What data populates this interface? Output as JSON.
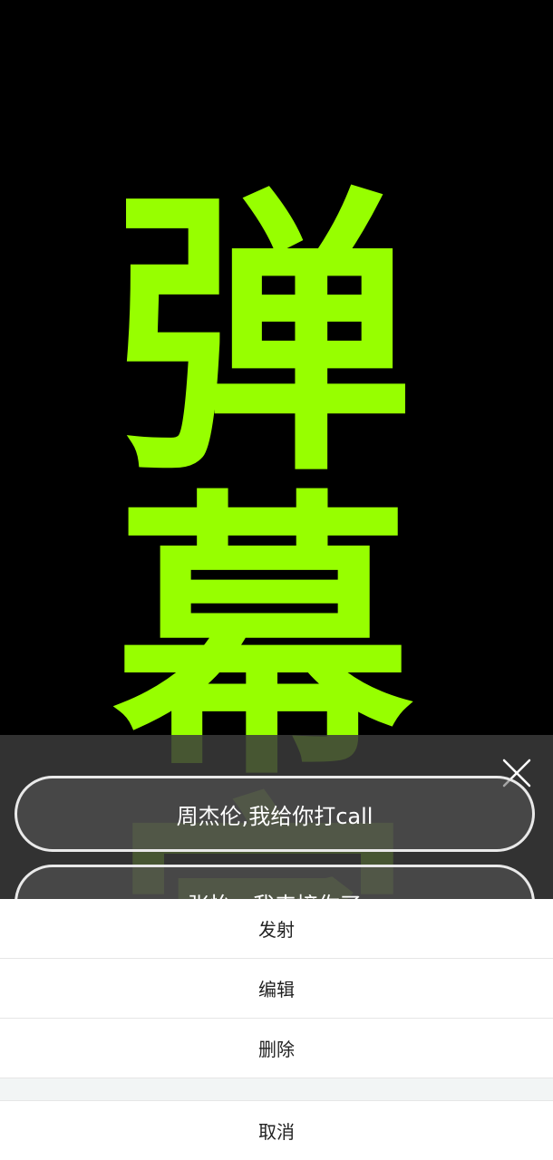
{
  "hero": {
    "chars": [
      "弹",
      "幕",
      "字"
    ],
    "color": "#97ff00"
  },
  "overlay": {
    "close_icon": "close-icon",
    "items": [
      {
        "label": "周杰伦,我给你打call"
      },
      {
        "label": "张怡，我来接你了"
      }
    ]
  },
  "sheet": {
    "actions": [
      {
        "label": "发射"
      },
      {
        "label": "编辑"
      },
      {
        "label": "删除"
      }
    ],
    "cancel_label": "取消"
  }
}
